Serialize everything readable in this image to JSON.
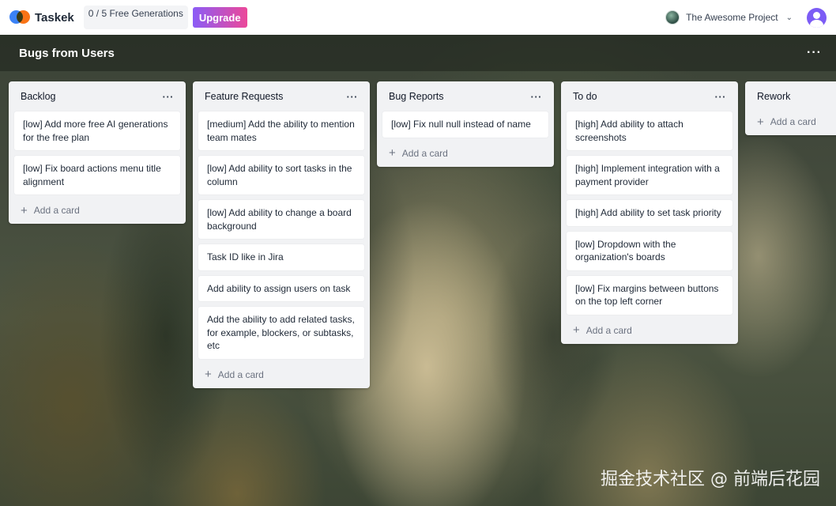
{
  "app": {
    "name": "Taskek",
    "generations": "0 / 5 Free Generations",
    "upgrade_label": "Upgrade",
    "project_name": "The Awesome Project"
  },
  "board": {
    "title": "Bugs from Users",
    "menu_icon": "more-horizontal-icon"
  },
  "add_card_label": "Add a card",
  "columns": [
    {
      "title": "Backlog",
      "cards": [
        "[low] Add more free AI generations for the free plan",
        "[low] Fix board actions menu title alignment"
      ]
    },
    {
      "title": "Feature Requests",
      "cards": [
        "[medium] Add the ability to mention team mates",
        "[low] Add ability to sort tasks in the column",
        "[low] Add ability to change a board background",
        "Task ID like in Jira",
        "Add ability to assign users on task",
        "Add the ability to add related tasks, for example, blockers, or subtasks, etc"
      ]
    },
    {
      "title": "Bug Reports",
      "cards": [
        "[low] Fix null null instead of name"
      ]
    },
    {
      "title": "To do",
      "cards": [
        "[high] Add ability to attach screenshots",
        "[high] Implement integration with a payment provider",
        "[high] Add ability to set task priority",
        "[low] Dropdown with the organization's boards",
        "[low] Fix margins between buttons on the top left corner"
      ]
    },
    {
      "title": "Rework",
      "cards": []
    }
  ],
  "watermark": "掘金技术社区 @ 前端后花园"
}
